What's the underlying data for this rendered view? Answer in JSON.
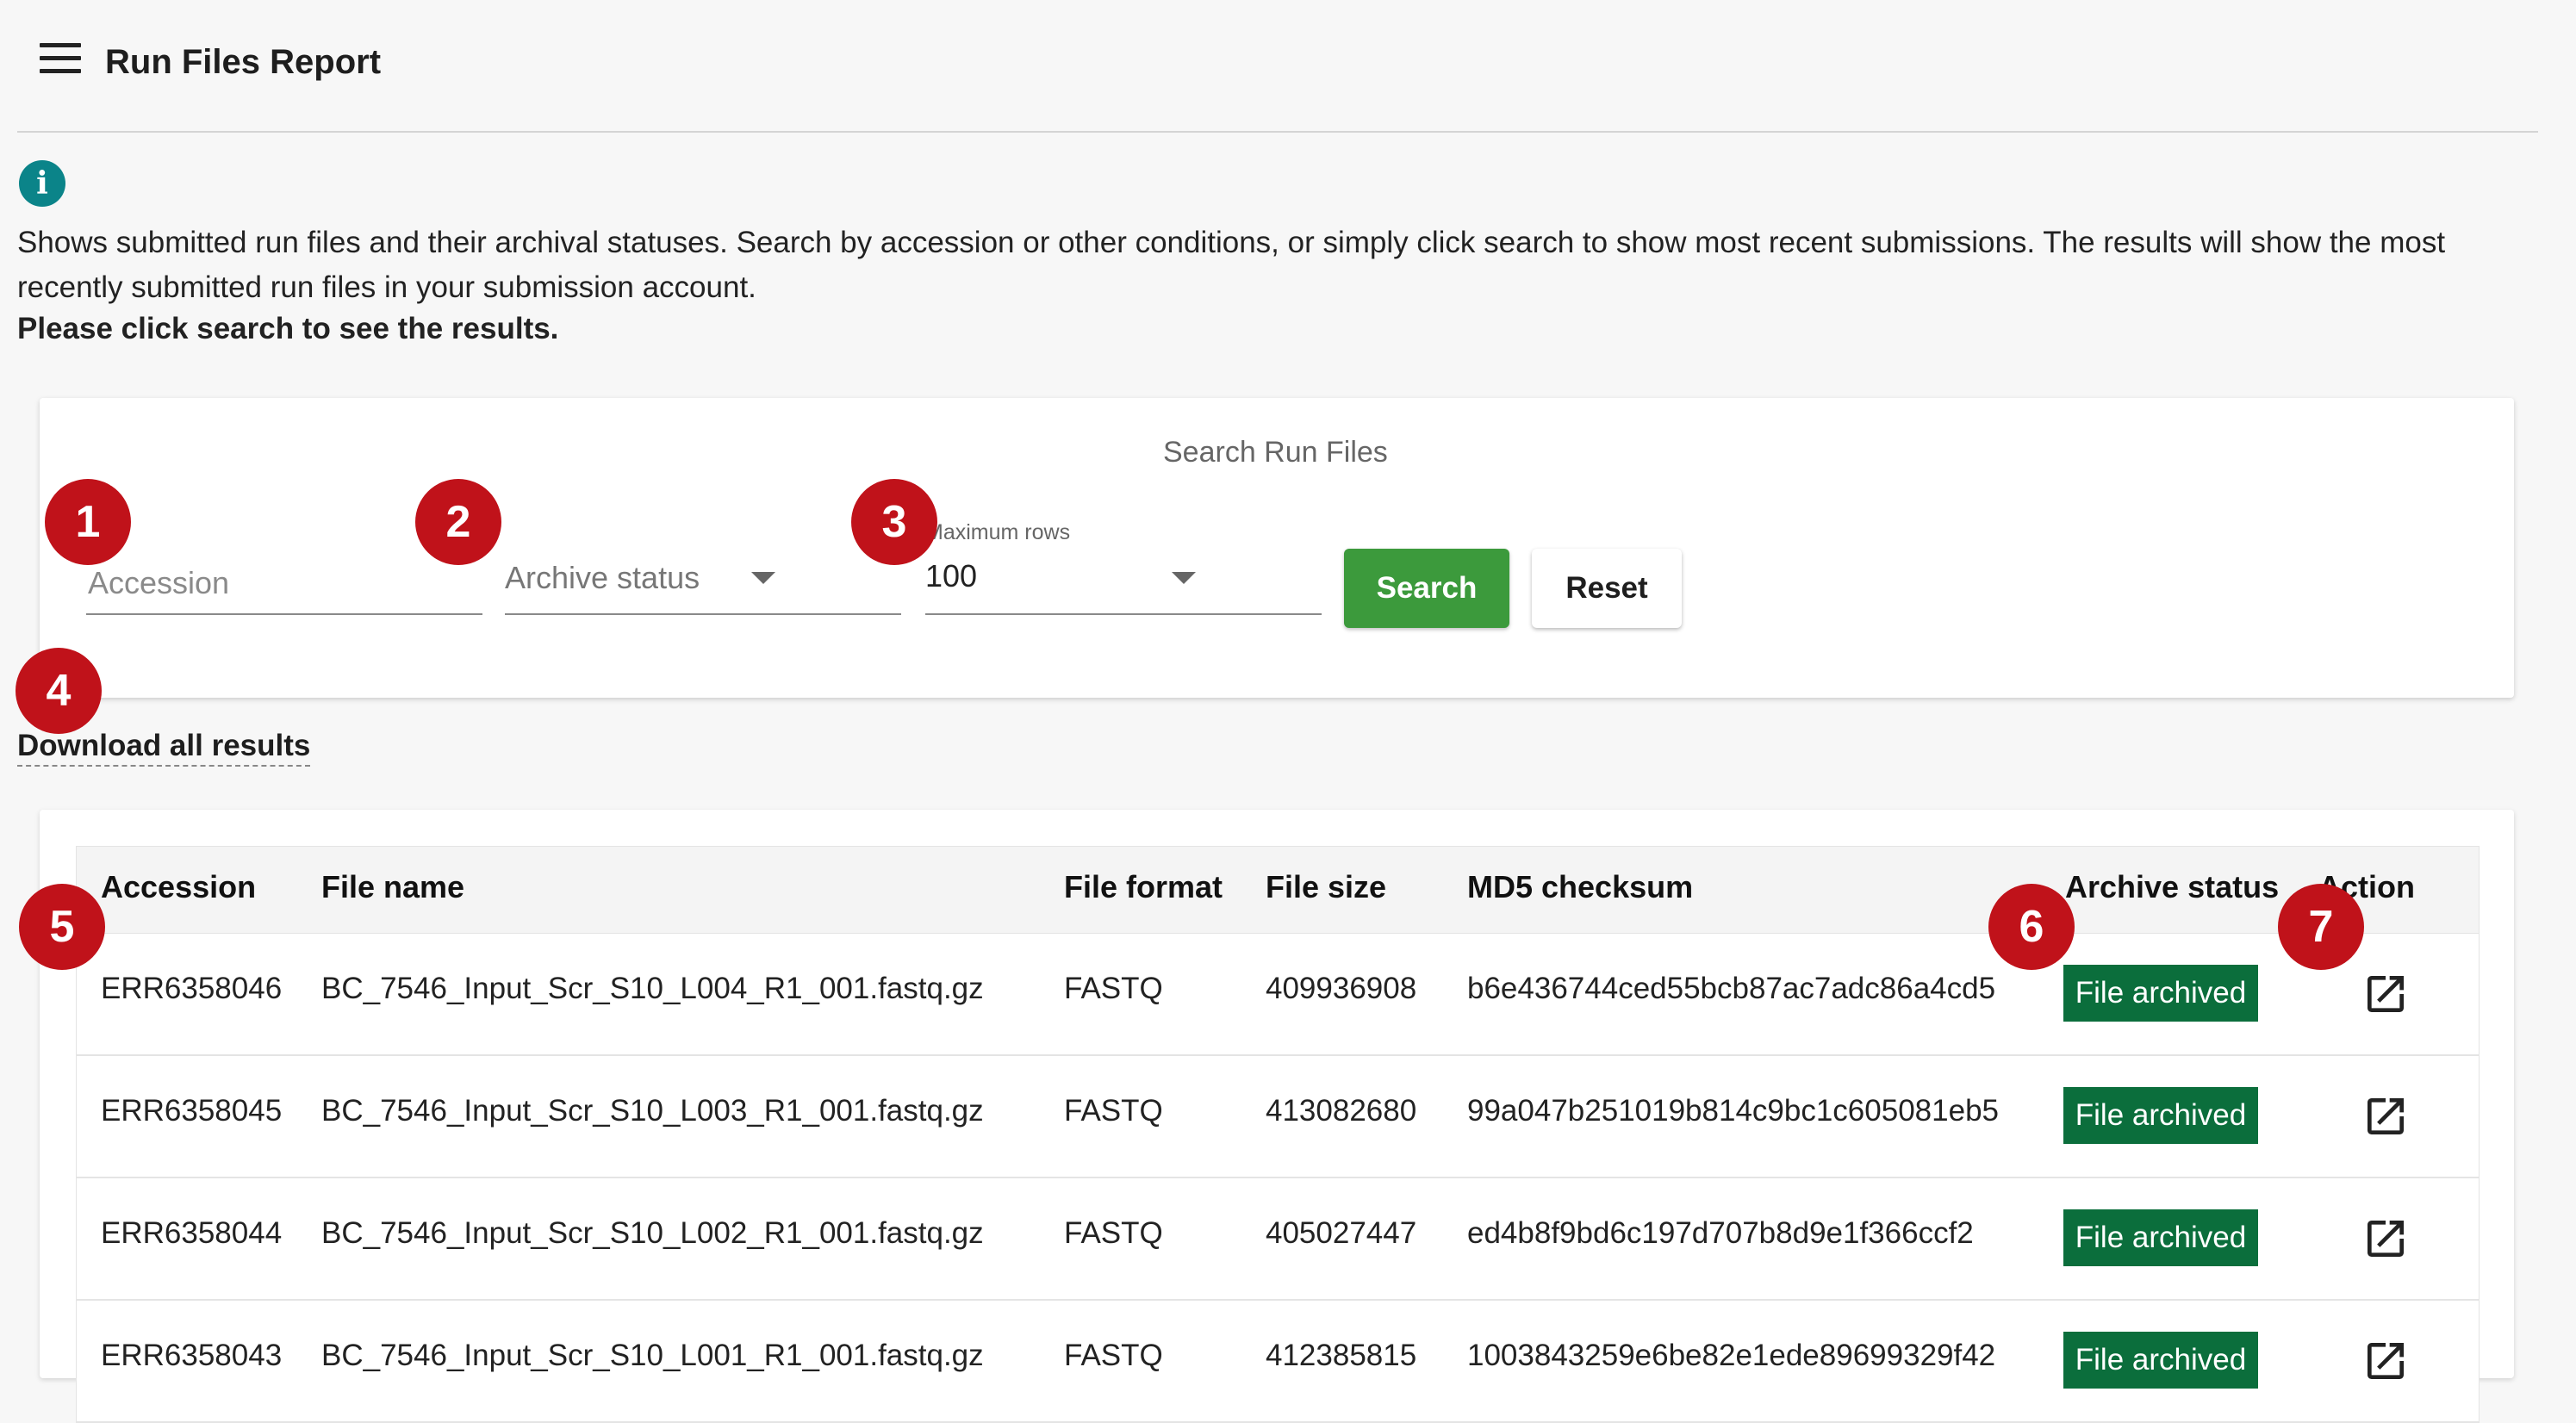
{
  "header": {
    "title": "Run Files Report"
  },
  "info": {
    "description": "Shows submitted run files and their archival statuses. Search by accession or other conditions, or simply click search to show most recent submissions. The results will show the most recently submitted run files in your submission account.",
    "prompt": "Please click search to see the results."
  },
  "search": {
    "title": "Search Run Files",
    "accession_placeholder": "Accession",
    "accession_value": "",
    "archive_status_label": "Archive status",
    "max_rows_label": "Maximum rows",
    "max_rows_value": "100",
    "search_label": "Search",
    "reset_label": "Reset"
  },
  "download_label": "Download all results",
  "table": {
    "headers": [
      "Accession",
      "File name",
      "File format",
      "File size",
      "MD5 checksum",
      "Archive status",
      "Action"
    ],
    "rows": [
      {
        "accession": "ERR6358046",
        "file_name": "BC_7546_Input_Scr_S10_L004_R1_001.fastq.gz",
        "format": "FASTQ",
        "size": "409936908",
        "md5": "b6e436744ced55bcb87ac7adc86a4cd5",
        "status": "File archived"
      },
      {
        "accession": "ERR6358045",
        "file_name": "BC_7546_Input_Scr_S10_L003_R1_001.fastq.gz",
        "format": "FASTQ",
        "size": "413082680",
        "md5": "99a047b251019b814c9bc1c605081eb5",
        "status": "File archived"
      },
      {
        "accession": "ERR6358044",
        "file_name": "BC_7546_Input_Scr_S10_L002_R1_001.fastq.gz",
        "format": "FASTQ",
        "size": "405027447",
        "md5": "ed4b8f9bd6c197d707b8d9e1f366ccf2",
        "status": "File archived"
      },
      {
        "accession": "ERR6358043",
        "file_name": "BC_7546_Input_Scr_S10_L001_R1_001.fastq.gz",
        "format": "FASTQ",
        "size": "412385815",
        "md5": "1003843259e6be82e1ede89699329f42",
        "status": "File archived"
      }
    ],
    "action_icon": "open-in-new-icon"
  },
  "markers": [
    "1",
    "2",
    "3",
    "4",
    "5",
    "6",
    "7"
  ],
  "colors": {
    "accent_green": "#3c9a3c",
    "archived_badge": "#0b6e3c",
    "info_teal": "#0b8489",
    "marker_red": "#c0121a"
  }
}
